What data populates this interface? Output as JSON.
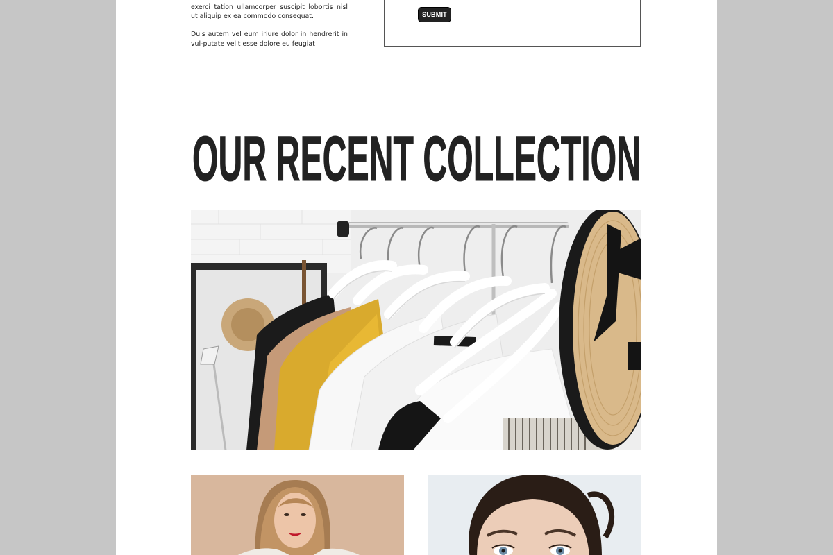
{
  "intro": {
    "paragraph_1": "exerci tation ullamcorper suscipit lobortis nisl ut aliquip ex ea commodo consequat.",
    "paragraph_2": "Duis autem vel eum iriure dolor in hendrerit in vul-putate velit esse dolore eu feugiat"
  },
  "form": {
    "submit_label": "SUBMIT"
  },
  "section": {
    "title": "OUR RECENT COLLECTION"
  },
  "colors": {
    "page_bg": "#ffffff",
    "outer_bg": "#c6c6c6",
    "text": "#222222",
    "button": "#222222"
  }
}
